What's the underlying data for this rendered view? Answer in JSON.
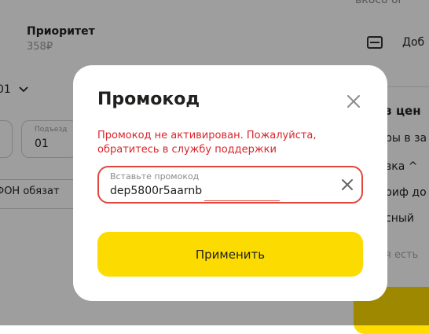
{
  "background": {
    "tariff_name": "Приоритет",
    "tariff_price": "358₽",
    "time_value": "01",
    "porch_label": "Подъезд",
    "porch_value": "01",
    "comment_text": "ФОН обязат",
    "top_cut_text": "вкосо ог",
    "add_card_text": "Доб",
    "right_panel": {
      "heading": "з цен",
      "line1": "ры в за",
      "line2": "вка ^",
      "line3": "риф до",
      "line4": "сный",
      "line5": "я есть"
    }
  },
  "modal": {
    "title": "Промокод",
    "error": "Промокод не активирован. Пожалуйста, обратитесь в службу поддержки",
    "field_label": "Вставьте промокод",
    "field_value": "dep5800r5aarnb",
    "apply_label": "Применить"
  },
  "colors": {
    "accent_yellow": "#fcdc00",
    "error_red": "#d8252c",
    "overlay": "rgba(0,0,0,0.38)"
  },
  "icons": {
    "close": "close-icon",
    "clear": "clear-icon",
    "card": "card-icon",
    "chevron": "chevron-down-icon"
  }
}
